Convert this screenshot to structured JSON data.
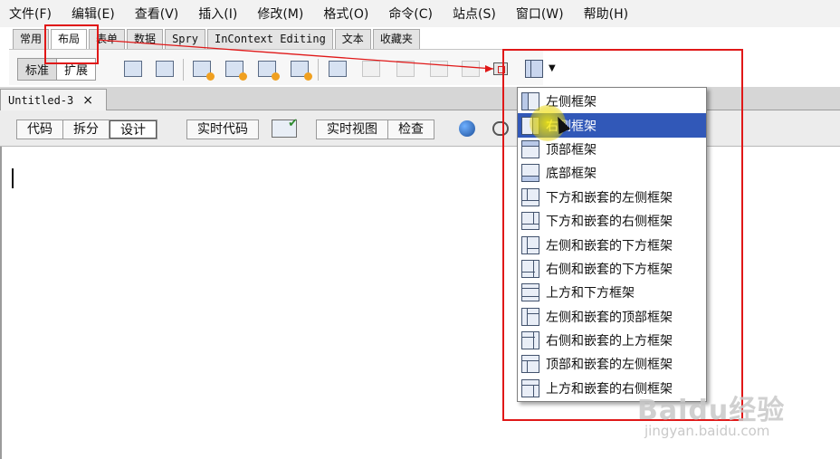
{
  "menubar": {
    "items": [
      "文件(F)",
      "编辑(E)",
      "查看(V)",
      "插入(I)",
      "修改(M)",
      "格式(O)",
      "命令(C)",
      "站点(S)",
      "窗口(W)",
      "帮助(H)"
    ]
  },
  "insert_tabs": [
    "常用",
    "布局",
    "表单",
    "数据",
    "Spry",
    "InContext Editing",
    "文本",
    "收藏夹"
  ],
  "insert_toolbar": {
    "mode_standard": "标准",
    "mode_expanded": "扩展"
  },
  "document": {
    "tab_title": "Untitled-3",
    "close_glyph": "×"
  },
  "doc_toolbar": {
    "code": "代码",
    "split": "拆分",
    "design": "设计",
    "live_code": "实时代码",
    "live_view": "实时视图",
    "inspect": "检查"
  },
  "frames_menu": {
    "items": [
      {
        "label": "左侧框架",
        "icon": "left-frame-icon"
      },
      {
        "label": "右侧框架",
        "icon": "right-frame-icon"
      },
      {
        "label": "顶部框架",
        "icon": "top-frame-icon"
      },
      {
        "label": "底部框架",
        "icon": "bottom-frame-icon"
      },
      {
        "label": "下方和嵌套的左侧框架",
        "icon": "bottom-nested-left-frame-icon"
      },
      {
        "label": "下方和嵌套的右侧框架",
        "icon": "bottom-nested-right-frame-icon"
      },
      {
        "label": "左侧和嵌套的下方框架",
        "icon": "left-nested-bottom-frame-icon"
      },
      {
        "label": "右侧和嵌套的下方框架",
        "icon": "right-nested-bottom-frame-icon"
      },
      {
        "label": "上方和下方框架",
        "icon": "top-bottom-frame-icon"
      },
      {
        "label": "左侧和嵌套的顶部框架",
        "icon": "left-nested-top-frame-icon"
      },
      {
        "label": "右侧和嵌套的上方框架",
        "icon": "right-nested-top-frame-icon"
      },
      {
        "label": "顶部和嵌套的左侧框架",
        "icon": "top-nested-left-frame-icon"
      },
      {
        "label": "上方和嵌套的右侧框架",
        "icon": "top-nested-right-frame-icon"
      }
    ],
    "selected_index": 1,
    "selection_color": "#3158b8"
  },
  "watermark": {
    "logo_text": "Baidu经验",
    "url_text": "jingyan.baidu.com"
  },
  "annotation_color": "#e01818"
}
